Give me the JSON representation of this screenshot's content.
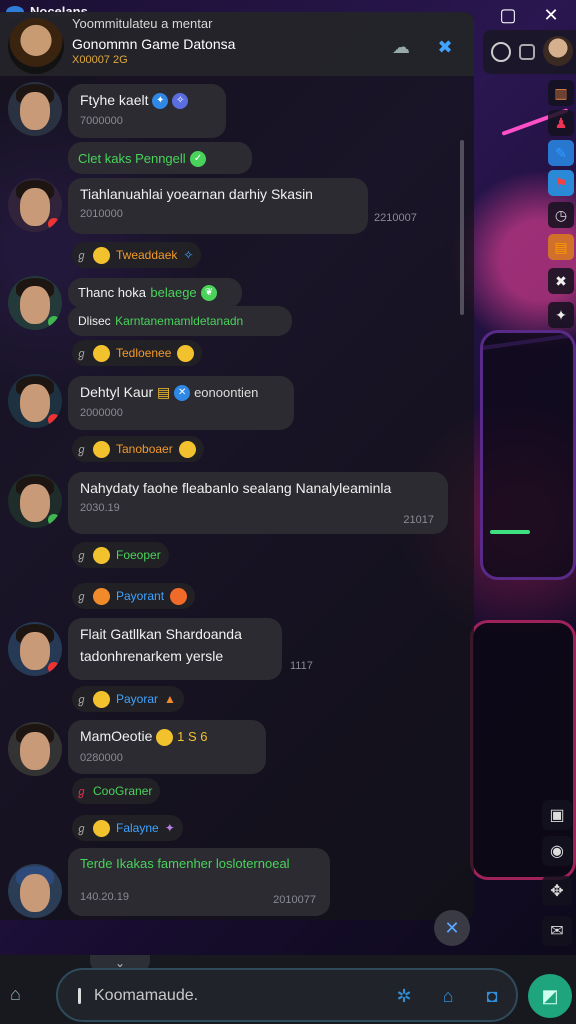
{
  "app": {
    "name": "Nocelans"
  },
  "window": {
    "maximize_glyph": "▢",
    "close_glyph": "✕"
  },
  "header": {
    "subtitle": "Yoommitulateu a mentar",
    "title": "Gonommn Game Datonsa",
    "count": "X00007 2G",
    "icons": [
      "cloud-icon",
      "crossed-tools-icon"
    ]
  },
  "right_top": {
    "icon": "timer-icon"
  },
  "messages": [
    {
      "name": "Ftyhe kaelt",
      "sub": "7000000",
      "icons": [
        "blue-badge",
        "sparkle"
      ]
    },
    {
      "name": "Clet kaks Penngell",
      "green": true,
      "sub": ""
    },
    {
      "name": "Tiahlanuahlai yoearnan darhiy Skasin",
      "sub": "2010000",
      "time": "2210007"
    },
    {
      "reaction": "Tweaddaek",
      "color": "orange"
    },
    {
      "name": "Thanc hoka",
      "name_green": "belaege",
      "line2": "Dlisec",
      "line2_green": "Karntanemamldetanadn"
    },
    {
      "reaction": "Tedloenee",
      "color": "orange"
    },
    {
      "name": "Dehtyl Kaur",
      "right": "eonoontien",
      "sub": "2000000"
    },
    {
      "reaction": "Tanoboaer",
      "color": "orange"
    },
    {
      "name": "Nahydaty faohe fleabanlo sealang Nanalyleaminla",
      "sub": "2030.19",
      "time": "21017"
    },
    {
      "reaction": "Foeoper",
      "color": "green"
    },
    {
      "reaction": "Payorant",
      "color": "blue"
    },
    {
      "name": "Flait Gatllkan Shardoanda",
      "line2": "tadonhrenarkem yersle",
      "time": "1117"
    },
    {
      "reaction": "Payorar",
      "color": "blue"
    },
    {
      "name": "MamOeotie",
      "extra": "1 S 6",
      "sub": "0280000"
    },
    {
      "reaction": "CooGraner",
      "color": "green"
    },
    {
      "reaction": "Falayne",
      "color": "blue"
    },
    {
      "name": "Terde Ikakas famenher losloternoeal",
      "green": true,
      "sub": "140.20.19",
      "time": "2010077"
    }
  ],
  "composer": {
    "placeholder": "Koomamaude."
  },
  "colors": {
    "accent": "#2f87e6",
    "send": "#1fa57d",
    "green": "#49d35b",
    "orange": "#f39a2b"
  }
}
